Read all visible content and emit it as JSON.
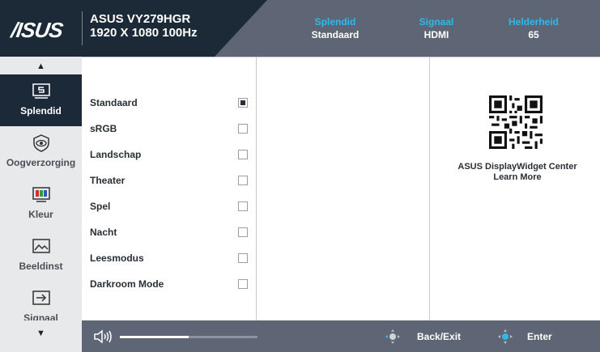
{
  "brand": {
    "logo": "/ISUS",
    "model_name": "ASUS VY279HGR",
    "model_spec": "1920 X 1080 100Hz"
  },
  "header": {
    "stats": [
      {
        "label": "Splendid",
        "value": "Standaard"
      },
      {
        "label": "Signaal",
        "value": "HDMI"
      },
      {
        "label": "Helderheid",
        "value": "65"
      }
    ]
  },
  "nav": {
    "items": [
      {
        "label": "Splendid",
        "icon": "splendid-icon",
        "active": true
      },
      {
        "label": "Oogverzorging",
        "icon": "eye-care-icon"
      },
      {
        "label": "Kleur",
        "icon": "color-icon"
      },
      {
        "label": "Beeldinst",
        "icon": "image-icon"
      },
      {
        "label": "Signaal",
        "icon": "input-signal-icon"
      }
    ]
  },
  "splendid": {
    "options": [
      {
        "label": "Standaard",
        "selected": true
      },
      {
        "label": "sRGB",
        "selected": false
      },
      {
        "label": "Landschap",
        "selected": false
      },
      {
        "label": "Theater",
        "selected": false
      },
      {
        "label": "Spel",
        "selected": false
      },
      {
        "label": "Nacht",
        "selected": false
      },
      {
        "label": "Leesmodus",
        "selected": false
      },
      {
        "label": "Darkroom Mode",
        "selected": false
      }
    ]
  },
  "widget": {
    "line1": "ASUS DisplayWidget Center",
    "line2": "Learn More"
  },
  "footer": {
    "volume_level": 0.5,
    "back_label": "Back/Exit",
    "enter_label": "Enter"
  },
  "colors": {
    "header_bg": "#5e6676",
    "brand_bg": "#1c2a38",
    "accent": "#2fb9e8",
    "active_nav": "#1b2939"
  }
}
